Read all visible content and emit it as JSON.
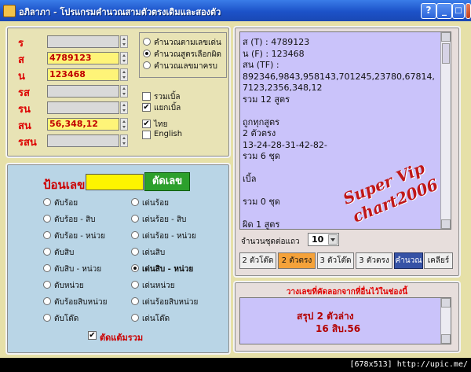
{
  "window": {
    "title": "อภิลาภา - โปรแกรมคำนวณสามตัวตรงเดิมและสองตัว",
    "buttons": [
      "?",
      "_",
      "□",
      "×"
    ]
  },
  "inputs": {
    "fields": [
      {
        "label": "ร",
        "value": "",
        "active": false
      },
      {
        "label": "ส",
        "value": "4789123",
        "active": true
      },
      {
        "label": "น",
        "value": "123468",
        "active": true
      },
      {
        "label": "รส",
        "value": "",
        "active": false
      },
      {
        "label": "รน",
        "value": "",
        "active": false
      },
      {
        "label": "สน",
        "value": "56,348,12",
        "active": true
      },
      {
        "label": "รสน",
        "value": "",
        "active": false
      }
    ],
    "mode_options": [
      {
        "label": "คำนวณตามเลขเด่น",
        "selected": false
      },
      {
        "label": "คำนวณสูตรเลือกผิด",
        "selected": true
      },
      {
        "label": "คำนวณเลขมาครบ",
        "selected": false
      }
    ],
    "checks": [
      {
        "label": "รวมเบิ้ล",
        "checked": false
      },
      {
        "label": "แยกเบิ้ล",
        "checked": true
      },
      {
        "label": "ไทย",
        "checked": true
      },
      {
        "label": "English",
        "checked": false
      }
    ]
  },
  "filter": {
    "label": "ป้อนเลข",
    "value": "",
    "cut_button": "ตัดเลข",
    "options_left": [
      {
        "label": "ตับร้อย",
        "selected": false
      },
      {
        "label": "ตับร้อย - สิบ",
        "selected": false
      },
      {
        "label": "ตับร้อย - หน่วย",
        "selected": false
      },
      {
        "label": "ตับสิบ",
        "selected": false
      },
      {
        "label": "ตับสิบ - หน่วย",
        "selected": false
      },
      {
        "label": "ตับหน่วย",
        "selected": false
      },
      {
        "label": "ตับร้อยสิบหน่วย",
        "selected": false
      },
      {
        "label": "ตับโต๊ด",
        "selected": false
      }
    ],
    "options_right": [
      {
        "label": "เด่นร้อย",
        "selected": false
      },
      {
        "label": "เด่นร้อย - สิบ",
        "selected": false
      },
      {
        "label": "เด่นร้อย - หน่วย",
        "selected": false
      },
      {
        "label": "เด่นสิบ",
        "selected": false
      },
      {
        "label": "เด่นสิบ - หน่วย",
        "selected": true
      },
      {
        "label": "เด่นหน่วย",
        "selected": false
      },
      {
        "label": "เด่นร้อยสิบหน่วย",
        "selected": false
      },
      {
        "label": "เด่นโต๊ด",
        "selected": false
      }
    ],
    "total_check": {
      "label": "ตัดแต้มรวม",
      "checked": true
    }
  },
  "output": {
    "lines": [
      "ส (T) : 4789123",
      "น (F) : 123468",
      "สน (TF) :",
      "892346,9843,958143,701245,23780,67814,7123,2356,348,12",
      "รวม 12 สูตร",
      "",
      "ถูกทุกสูตร",
      "2 ตัวตรง",
      "13-24-28-31-42-82-",
      "รวม 6 ชุด",
      "",
      "เบิ้ล",
      "",
      "รวม 0 ชุด",
      "",
      "ผิด 1 สูตร"
    ],
    "watermark_line1": "Super Vip",
    "watermark_line2": "chart2006",
    "per_line_label": "จำนวนชุดต่อแถว",
    "per_line_value": "10",
    "tabs": [
      {
        "label": "2 ตัวโต๊ด",
        "style": "normal"
      },
      {
        "label": "2 ตัวตรง",
        "style": "active"
      },
      {
        "label": "3 ตัวโต๊ด",
        "style": "normal"
      },
      {
        "label": "3 ตัวตรง",
        "style": "normal"
      },
      {
        "label": "คำนวณ",
        "style": "dark"
      },
      {
        "label": "เคลียร์",
        "style": "normal"
      }
    ]
  },
  "summary": {
    "title": "วางเลขที่คัดลอกจากที่อื่นไว้ในช่องนี้",
    "line1": "สรุป 2 ตัวล่าง",
    "line2": "16 สิบ.56"
  },
  "credit": "[678x513] http://upic.me/"
}
